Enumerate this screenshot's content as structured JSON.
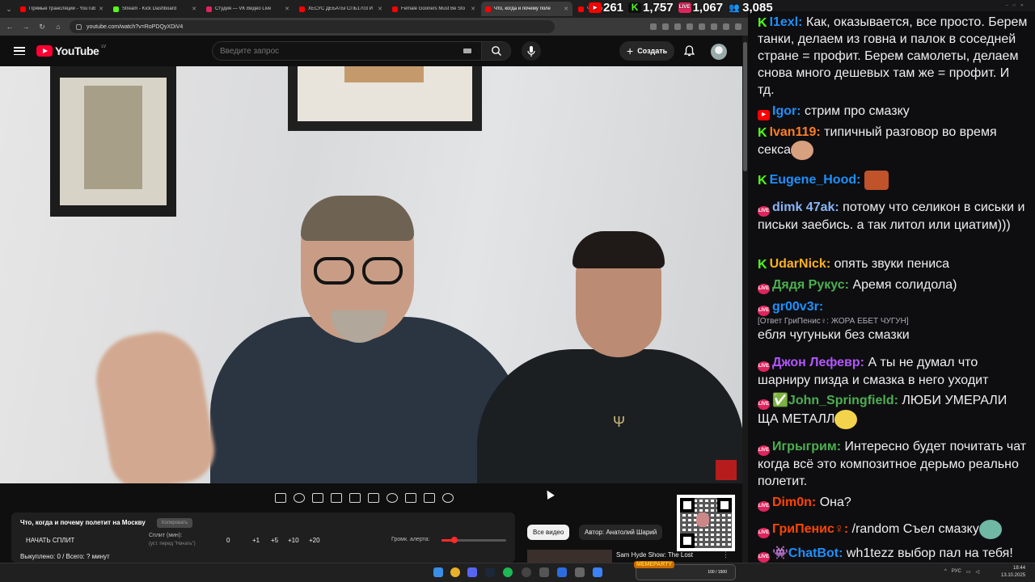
{
  "browser": {
    "tabs": [
      {
        "title": "Прямые трансляции - YouTube",
        "color": "#ff0000"
      },
      {
        "title": "Stream - Kick Dashboard",
        "color": "#53fc18"
      },
      {
        "title": "Студия — VK Видео Live",
        "color": "#e0245e"
      },
      {
        "title": "ХЕСУС ДЕБАТЫ СПБ1703 И",
        "color": "#ff0000"
      },
      {
        "title": "Female Gooners Must Be Sto",
        "color": "#ff0000"
      },
      {
        "title": "Что, когда и почему поле",
        "color": "#ff0000",
        "active": true
      },
      {
        "title": "Что, ко",
        "color": "#ff0000"
      }
    ],
    "url": "youtube.com/watch?v=RoPDQyXDiV4"
  },
  "overlay_stats": [
    {
      "icon": "youtube",
      "value": "261",
      "color": "#ff0000"
    },
    {
      "icon": "kick",
      "value": "1,757",
      "color": "#53fc18"
    },
    {
      "icon": "vk-live",
      "value": "1,067",
      "color": "#e0245e"
    },
    {
      "icon": "people",
      "value": "3,085",
      "color": "#5aa0ff"
    }
  ],
  "youtube": {
    "logo": "YouTube",
    "region": "LV",
    "search_placeholder": "Введите запрос",
    "create_label": "Создать"
  },
  "split_panel": {
    "title": "Что, когда и почему полетит на Москву",
    "copy_label": "Копировать",
    "start_label": "НАЧАТЬ СПЛИТ",
    "split_min_label": "Сплит (мин):",
    "split_hint": "(уст. перед \"Начать\")",
    "split_value": "0",
    "increments": [
      "+1",
      "+5",
      "+10",
      "+20"
    ],
    "volume_label": "Громк. алерта:",
    "volume_level": 0.2,
    "totals": "Выкуплено: 0 / Всего: ? минут"
  },
  "filters": {
    "all_videos": "Все видео",
    "author": "Автор: Анатолий Шарий"
  },
  "related": {
    "title": "Sam Hyde Show: The Lost"
  },
  "chat": {
    "messages": [
      {
        "platform": "kick",
        "name": "I1exl:",
        "name_color": "#1e90ff",
        "text": "Как, оказывается, все просто. Берем танки, делаем из говна и палок в соседней стране = профит. Берем самолеты, делаем снова много дешевых там же = профит. И тд."
      },
      {
        "platform": "youtube",
        "name": "Igor:",
        "name_color": "#1e90ff",
        "text": "стрим про смазку"
      },
      {
        "platform": "kick",
        "name": "Ivan119:",
        "name_color": "#ff7f24",
        "text": "типичный разговор во время секса"
      },
      {
        "platform": "kick",
        "name": "Eugene_Hood:",
        "name_color": "#1e90ff",
        "text": ""
      },
      {
        "platform": "vk",
        "name": "dimk 47ak:",
        "name_color": "#8ab4f8",
        "text": "потому что селикон в сиськи и письки заебись. а так литол или циатим)))"
      },
      {
        "platform": "kick",
        "name": "UdarNick:",
        "name_color": "#ffb020",
        "text": "опять звуки пениса"
      },
      {
        "platform": "vk",
        "name": "Дядя Рукус:",
        "name_color": "#4caf50",
        "text": "Аремя солидола)"
      },
      {
        "platform": "vk",
        "name": "gr00v3r:",
        "name_color": "#1e90ff",
        "reply": "[Ответ ГриПенис♀: ЖОРА ЕБЕТ ЧУГУН]",
        "text": "ебля чугуньки без смазки"
      },
      {
        "platform": "vk",
        "name": "Джон Лефевр:",
        "name_color": "#b455ff",
        "text": "А ты не думал что шарниру пизда и смазка в него уходит"
      },
      {
        "platform": "vk",
        "name": "✅John_Springfield:",
        "name_color": "#4caf50",
        "text": "ЛЮБИ УМЕРАЛИ ЩА МЕТАЛЛ"
      },
      {
        "platform": "vk",
        "name": "Игрыгрим:",
        "name_color": "#4caf50",
        "text": "Интересно будет почитать чат когда всё это композитное дерьмо реально полетит."
      },
      {
        "platform": "vk",
        "name": "Dim0n:",
        "name_color": "#ff4500",
        "text": "Она?"
      },
      {
        "platform": "vk",
        "name": "ГриПенис♀:",
        "name_color": "#ff4500",
        "text": "/random Съел смазку"
      },
      {
        "platform": "vk",
        "name": "👾ChatBot:",
        "name_color": "#1e90ff",
        "text": "wh1tezz выбор пал на тебя!"
      }
    ]
  },
  "taskbar": {
    "party_tag": "MEMEPARTY",
    "party_value": "100 / 1500",
    "lang": "РУС",
    "time": "18:44",
    "date": "13.10.2025"
  }
}
